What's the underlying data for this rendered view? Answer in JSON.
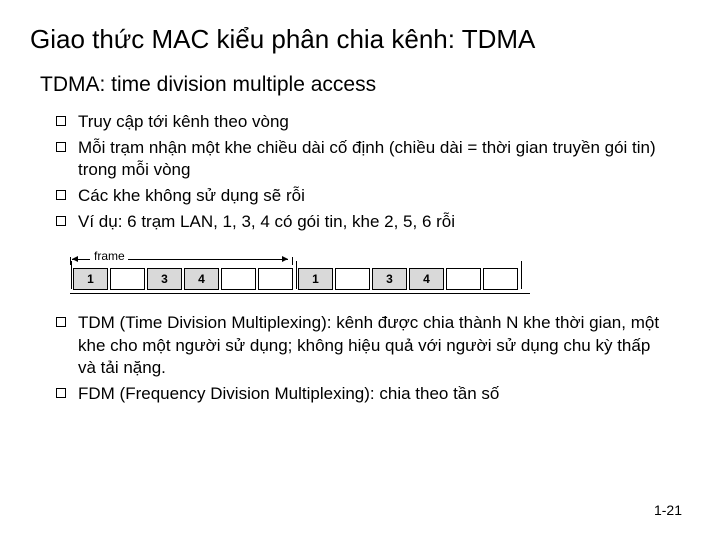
{
  "title": "Giao thức MAC kiểu phân chia kênh: TDMA",
  "subtitle": "TDMA: time division multiple access",
  "bullets_top": [
    "Truy cập tới kênh theo vòng",
    "Mỗi trạm nhận một khe chiều dài cố định (chiều dài = thời gian truyền gói tin) trong mỗi vòng",
    "Các khe không sử dụng sẽ rỗi",
    "Ví dụ: 6 trạm LAN, 1, 3, 4 có gói tin, khe 2, 5, 6 rỗi"
  ],
  "diagram": {
    "frame_label": "frame",
    "frames": [
      [
        {
          "label": "1",
          "filled": true
        },
        {
          "label": "",
          "filled": false
        },
        {
          "label": "3",
          "filled": true
        },
        {
          "label": "4",
          "filled": true
        },
        {
          "label": "",
          "filled": false
        },
        {
          "label": "",
          "filled": false
        }
      ],
      [
        {
          "label": "1",
          "filled": true
        },
        {
          "label": "",
          "filled": false
        },
        {
          "label": "3",
          "filled": true
        },
        {
          "label": "4",
          "filled": true
        },
        {
          "label": "",
          "filled": false
        },
        {
          "label": "",
          "filled": false
        }
      ]
    ]
  },
  "bullets_bottom": [
    "TDM (Time Division Multiplexing): kênh được chia thành N khe thời gian, một khe cho một người sử dụng; không hiệu quả với người sử dụng chu kỳ thấp và tải nặng.",
    "FDM (Frequency Division Multiplexing): chia theo tần số"
  ],
  "page_number": "1-21"
}
